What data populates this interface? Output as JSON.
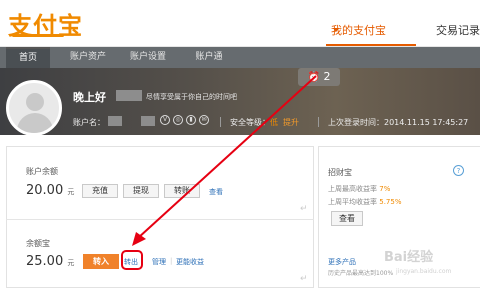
{
  "header": {
    "logo_text": "支付宝",
    "nav_mine": "我的支付宝",
    "nav_trade": "交易记录"
  },
  "tabs": [
    {
      "label": "首页",
      "active": true
    },
    {
      "label": "账户资产",
      "active": false
    },
    {
      "label": "账户设置",
      "active": false
    },
    {
      "label": "账户通",
      "active": false
    }
  ],
  "banner": {
    "greeting": "晚上好",
    "slogan": "尽情享受属于你自己的时间吧",
    "account_label": "账户名：",
    "security_label": "安全等级：",
    "security_level": "低",
    "security_upgrade": "提升",
    "last_login": "上次登录时间：2014.11.15 17:45:27",
    "notification_count": "2"
  },
  "balance": {
    "label": "账户余额",
    "amount": "20.00",
    "unit": "元",
    "buttons": [
      "充值",
      "提现",
      "转账"
    ],
    "view_link": "查看"
  },
  "yuebao": {
    "label": "余额宝",
    "amount": "25.00",
    "unit": "元",
    "transfer_in": "转入",
    "transfer_out": "转出",
    "manage": "管理",
    "more_income": "更能收益"
  },
  "zhaocaibao": {
    "title": "招财宝",
    "week_high": "上周最高收益率",
    "week_high_rate": "7%",
    "week_avg": "上周平均收益率",
    "week_avg_rate": "5.75%",
    "view_button": "查看",
    "more_products": "更多产品",
    "history": "历史产品最高达到100%"
  },
  "watermark": {
    "text": "Bai经验",
    "url": "jingyan.baidu.com"
  },
  "colors": {
    "accent": "#f08a00",
    "highlight_red": "#e60012",
    "link": "#2c6fb7"
  }
}
